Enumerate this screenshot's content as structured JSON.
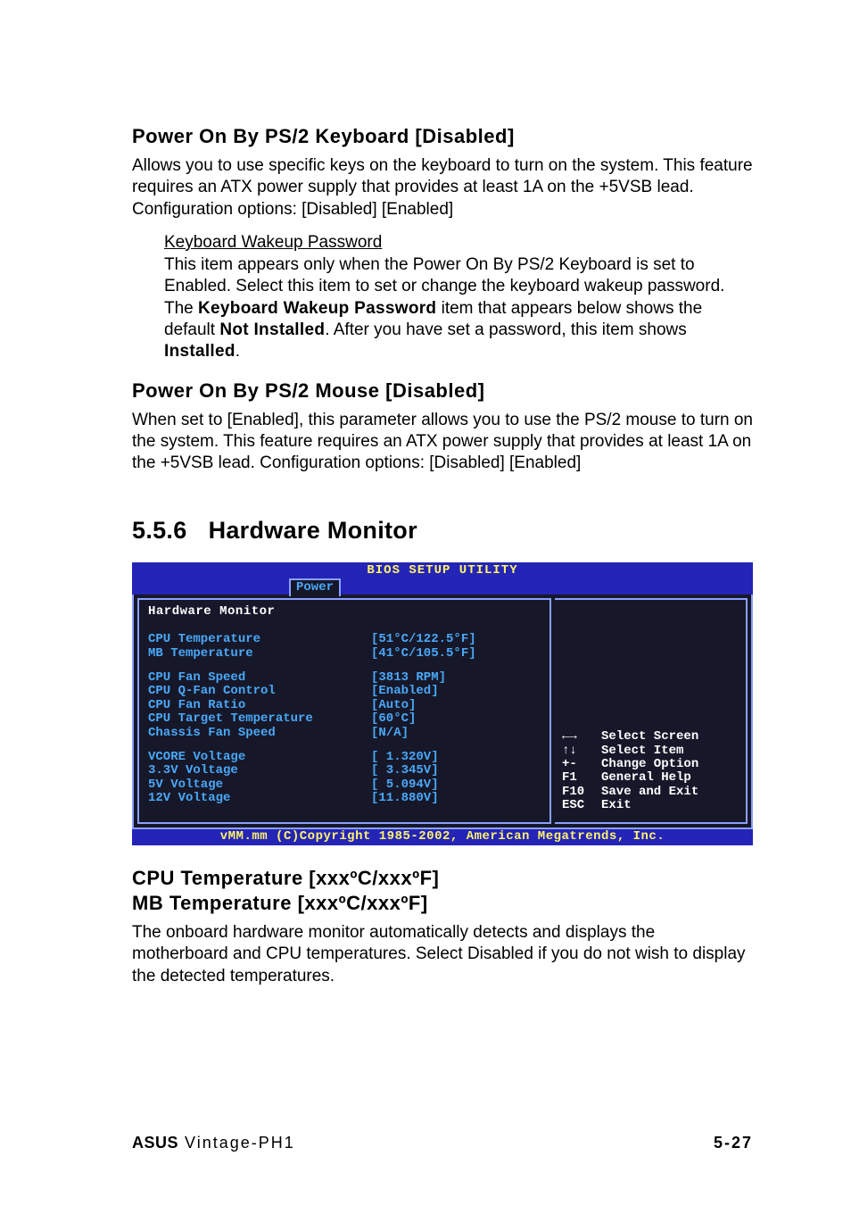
{
  "sec1": {
    "title": "Power On By PS/2 Keyboard [Disabled]",
    "body": "Allows you to use specific keys on the keyboard to turn on the system. This feature requires an ATX power supply that provides at least 1A on the +5VSB lead. Configuration options: [Disabled] [Enabled]",
    "sub_title": "Keyboard Wakeup Password",
    "sub_pre": "This item appears only when the Power On By PS/2 Keyboard is set to Enabled.  Select this item to set or change the keyboard wakeup password.  The ",
    "sub_bold1": "Keyboard Wakeup Password",
    "sub_mid1": " item that appears below shows the default ",
    "sub_bold2": "Not Installed",
    "sub_mid2": ". After you have set a password, this item shows ",
    "sub_bold3": "Installed",
    "sub_end": "."
  },
  "sec2": {
    "title": "Power On By PS/2 Mouse [Disabled]",
    "body": "When set to [Enabled], this parameter allows you to use the PS/2 mouse to turn on the system. This feature requires an ATX power supply that provides at least 1A on the +5VSB lead. Configuration options: [Disabled] [Enabled]"
  },
  "sec3": {
    "num": "5.5.6",
    "title": "Hardware Monitor"
  },
  "bios": {
    "top": "BIOS SETUP UTILITY",
    "tab": "Power",
    "heading": "Hardware Monitor",
    "group1": [
      {
        "label": "CPU Temperature",
        "value": "[51°C/122.5°F]"
      },
      {
        "label": "MB Temperature",
        "value": "[41°C/105.5°F]"
      }
    ],
    "group2": [
      {
        "label": "CPU Fan Speed",
        "value": "[3813 RPM]"
      },
      {
        "label": "CPU Q-Fan Control",
        "value": "[Enabled]"
      },
      {
        "label": "CPU Fan Ratio",
        "value": "[Auto]"
      },
      {
        "label": "CPU Target Temperature",
        "value": "[60°C]"
      },
      {
        "label": "Chassis Fan Speed",
        "value": "[N/A]"
      }
    ],
    "group3": [
      {
        "label": "VCORE Voltage",
        "value": "[ 1.320V]"
      },
      {
        "label": "3.3V Voltage",
        "value": "[ 3.345V]"
      },
      {
        "label": "5V Voltage",
        "value": "[ 5.094V]"
      },
      {
        "label": "12V Voltage",
        "value": "[11.880V]"
      }
    ],
    "legend": [
      {
        "k": "←→",
        "d": "Select Screen"
      },
      {
        "k": "↑↓",
        "d": "Select Item"
      },
      {
        "k": "+-",
        "d": "Change Option"
      },
      {
        "k": "F1",
        "d": "General Help"
      },
      {
        "k": "F10",
        "d": "Save and Exit"
      },
      {
        "k": "ESC",
        "d": "Exit"
      }
    ],
    "bottom": "vMM.mm (C)Copyright 1985-2002, American Megatrends, Inc."
  },
  "sec4": {
    "title1": "CPU Temperature [xxxºC/xxxºF]",
    "title2": "MB Temperature [xxxºC/xxxºF]",
    "body": "The onboard hardware monitor automatically detects and displays the motherboard and CPU temperatures. Select Disabled if you do not wish to display the detected temperatures."
  },
  "footer": {
    "brand": "ASUS",
    "model": " Vintage-PH1",
    "page": "5-27"
  }
}
